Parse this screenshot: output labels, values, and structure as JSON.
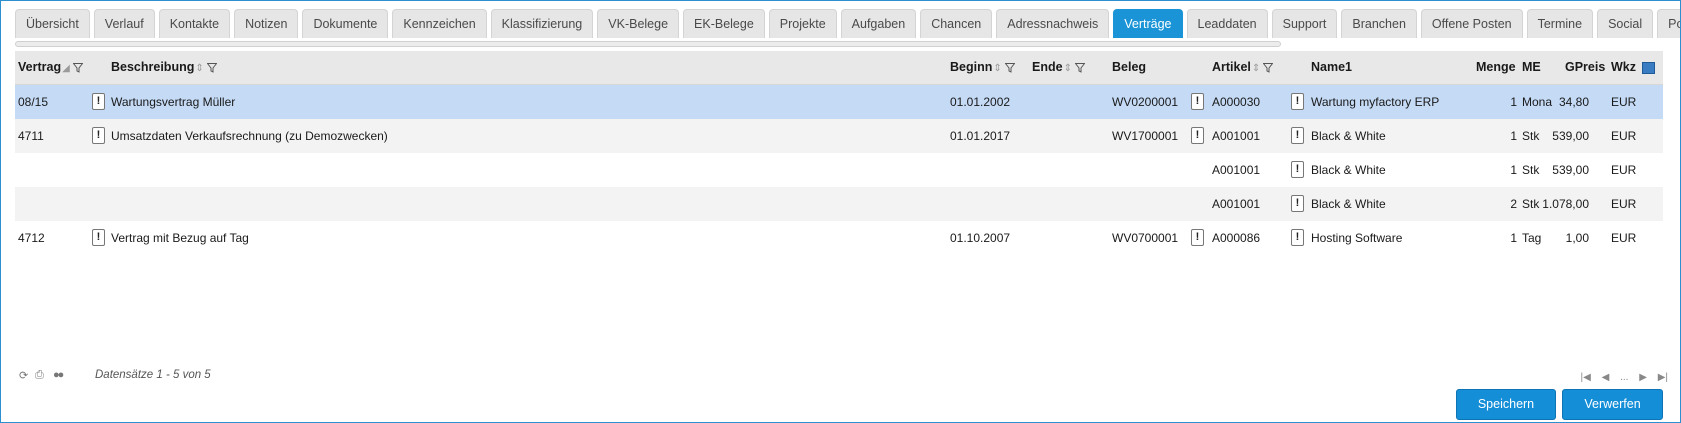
{
  "tabs": [
    {
      "label": "Übersicht",
      "active": false
    },
    {
      "label": "Verlauf",
      "active": false
    },
    {
      "label": "Kontakte",
      "active": false
    },
    {
      "label": "Notizen",
      "active": false
    },
    {
      "label": "Dokumente",
      "active": false
    },
    {
      "label": "Kennzeichen",
      "active": false
    },
    {
      "label": "Klassifizierung",
      "active": false
    },
    {
      "label": "VK-Belege",
      "active": false
    },
    {
      "label": "EK-Belege",
      "active": false
    },
    {
      "label": "Projekte",
      "active": false
    },
    {
      "label": "Aufgaben",
      "active": false
    },
    {
      "label": "Chancen",
      "active": false
    },
    {
      "label": "Adressnachweis",
      "active": false
    },
    {
      "label": "Verträge",
      "active": true
    },
    {
      "label": "Leaddaten",
      "active": false
    },
    {
      "label": "Support",
      "active": false
    },
    {
      "label": "Branchen",
      "active": false
    },
    {
      "label": "Offene Posten",
      "active": false
    },
    {
      "label": "Termine",
      "active": false
    },
    {
      "label": "Social",
      "active": false
    },
    {
      "label": "Portalbesuche",
      "active": false
    }
  ],
  "grid": {
    "columns": {
      "vertrag": "Vertrag",
      "beschreibung": "Beschreibung",
      "beginn": "Beginn",
      "ende": "Ende",
      "beleg": "Beleg",
      "artikel": "Artikel",
      "name1": "Name1",
      "menge": "Menge",
      "me": "ME",
      "gpreis": "GPreis",
      "wkz": "Wkz"
    },
    "rows": [
      {
        "vertrag": "08/15",
        "beschreibung": "Wartungsvertrag Müller",
        "beginn": "01.01.2002",
        "ende": "",
        "beleg": "WV0200001",
        "artikel": "A000030",
        "name1": "Wartung myfactory ERP",
        "menge": "1",
        "me": "Mona",
        "gpreis": "34,80",
        "wkz": "EUR",
        "selected": true
      },
      {
        "vertrag": "4711",
        "beschreibung": "Umsatzdaten Verkaufsrechnung (zu Demozwecken)",
        "beginn": "01.01.2017",
        "ende": "",
        "beleg": "WV1700001",
        "artikel": "A001001",
        "name1": "Black & White",
        "menge": "1",
        "me": "Stk",
        "gpreis": "539,00",
        "wkz": "EUR"
      },
      {
        "vertrag": "",
        "beschreibung": "",
        "beginn": "",
        "ende": "",
        "beleg": "",
        "artikel": "A001001",
        "name1": "Black & White",
        "menge": "1",
        "me": "Stk",
        "gpreis": "539,00",
        "wkz": "EUR"
      },
      {
        "vertrag": "",
        "beschreibung": "",
        "beginn": "",
        "ende": "",
        "beleg": "",
        "artikel": "A001001",
        "name1": "Black & White",
        "menge": "2",
        "me": "Stk",
        "gpreis": "1.078,00",
        "wkz": "EUR"
      },
      {
        "vertrag": "4712",
        "beschreibung": "Vertrag mit Bezug auf Tag",
        "beginn": "01.10.2007",
        "ende": "",
        "beleg": "WV0700001",
        "artikel": "A000086",
        "name1": "Hosting Software",
        "menge": "1",
        "me": "Tag",
        "gpreis": "1,00",
        "wkz": "EUR"
      }
    ]
  },
  "footer": {
    "records": "Datensätze 1 - 5 von 5",
    "pager_ellipsis": "..."
  },
  "buttons": {
    "save": "Speichern",
    "discard": "Verwerfen"
  },
  "colors": {
    "accent": "#1a94d6",
    "selected_row": "#c4daf5"
  },
  "icons": [
    "refresh-icon",
    "print-icon",
    "settings-dots-icon",
    "filter-icon",
    "sort-icon",
    "column-settings-icon",
    "info-exclamation-icon",
    "first-page-icon",
    "prev-page-icon",
    "next-page-icon",
    "last-page-icon"
  ]
}
